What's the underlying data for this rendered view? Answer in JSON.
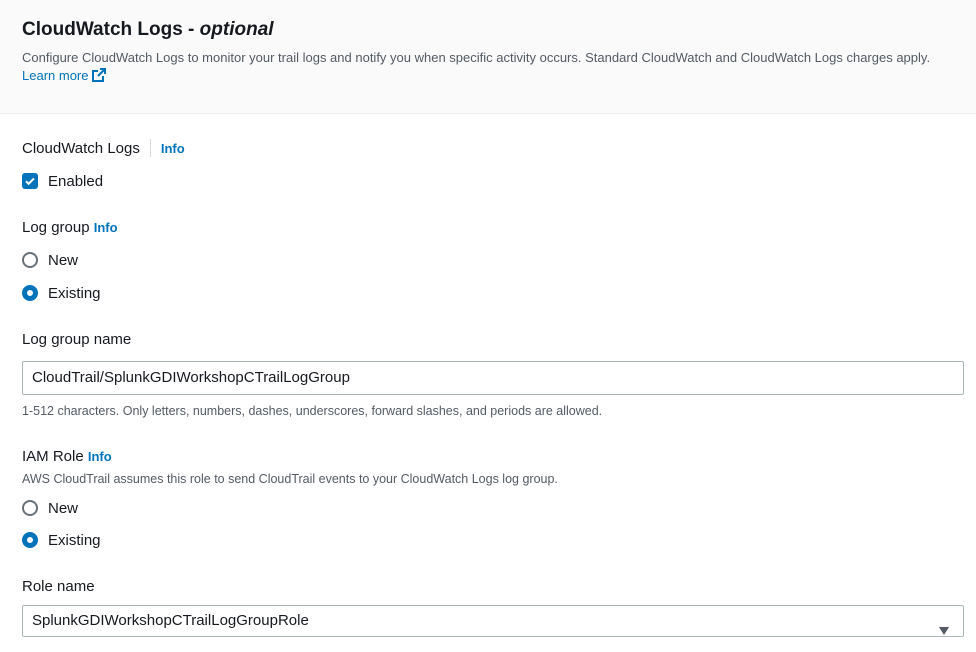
{
  "header": {
    "title_main": "CloudWatch Logs -",
    "title_optional": "optional",
    "description": "Configure CloudWatch Logs to monitor your trail logs and notify you when specific activity occurs. Standard CloudWatch and CloudWatch Logs charges apply.",
    "learn_more": "Learn more"
  },
  "cloudwatch_logs": {
    "label": "CloudWatch Logs",
    "info": "Info",
    "enabled_label": "Enabled",
    "enabled": true
  },
  "log_group": {
    "label": "Log group",
    "info": "Info",
    "options": [
      "New",
      "Existing"
    ],
    "selected": "Existing"
  },
  "log_group_name": {
    "label": "Log group name",
    "value": "CloudTrail/SplunkGDIWorkshopCTrailLogGroup",
    "hint": "1-512 characters. Only letters, numbers, dashes, underscores, forward slashes, and periods are allowed."
  },
  "iam_role": {
    "label": "IAM Role",
    "info": "Info",
    "description": "AWS CloudTrail assumes this role to send CloudTrail events to your CloudWatch Logs log group.",
    "options": [
      "New",
      "Existing"
    ],
    "selected": "Existing"
  },
  "role_name": {
    "label": "Role name",
    "value": "SplunkGDIWorkshopCTrailLogGroupRole"
  },
  "colors": {
    "accent": "#0073bb",
    "header_bg": "#fafafa"
  },
  "icons": [
    "external-link-icon",
    "check-icon",
    "caret-down-icon"
  ]
}
